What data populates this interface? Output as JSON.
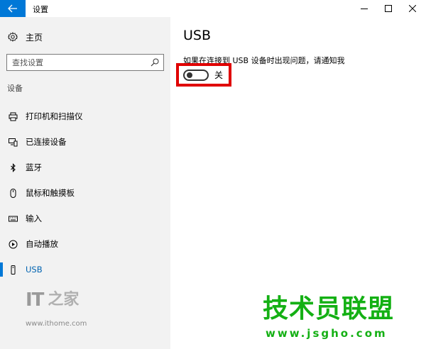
{
  "window": {
    "title": "设置",
    "back_icon": "back-arrow-icon",
    "controls": [
      "minimize-icon",
      "maximize-icon",
      "close-icon"
    ]
  },
  "sidebar": {
    "home_label": "主页",
    "home_icon": "gear-icon",
    "search": {
      "placeholder": "查找设置",
      "value": "",
      "icon": "search-icon"
    },
    "section_heading": "设备",
    "items": [
      {
        "label": "打印机和扫描仪",
        "icon": "printer-icon",
        "active": false
      },
      {
        "label": "已连接设备",
        "icon": "connected-devices-icon",
        "active": false
      },
      {
        "label": "蓝牙",
        "icon": "bluetooth-icon",
        "active": false
      },
      {
        "label": "鼠标和触摸板",
        "icon": "mouse-icon",
        "active": false
      },
      {
        "label": "输入",
        "icon": "keyboard-icon",
        "active": false
      },
      {
        "label": "自动播放",
        "icon": "autoplay-icon",
        "active": false
      },
      {
        "label": "USB",
        "icon": "usb-icon",
        "active": true
      }
    ]
  },
  "main": {
    "title": "USB",
    "setting_description": "如果在连接到 USB 设备时出现问题，请通知我",
    "toggle": {
      "state": "off",
      "label": "关"
    }
  },
  "watermarks": {
    "left_logo_text": "IT",
    "left_logo_glyph": "之家",
    "left_url": "www.ithome.com",
    "right_brand": "技术员联盟",
    "right_url": "www.jsgho.com"
  },
  "colors": {
    "accent": "#0078d7",
    "sidebar_bg": "#f2f2f2",
    "highlight_red": "#e00000",
    "watermark_green": "#14b014"
  }
}
